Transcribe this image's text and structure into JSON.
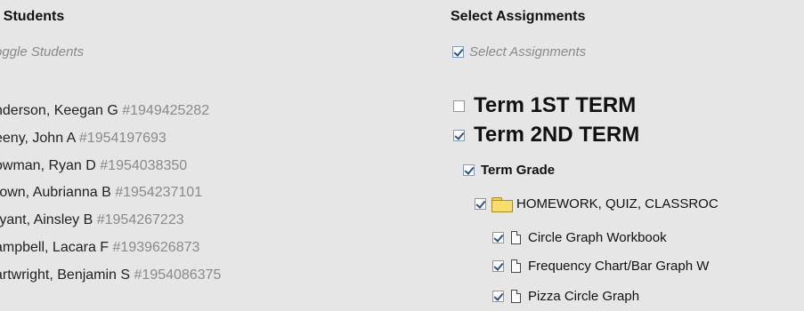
{
  "students_panel": {
    "title": "t Students",
    "toggle_label": "oggle Students",
    "students": [
      {
        "name": "nderson, Keegan G",
        "id": "#1949425282"
      },
      {
        "name": "eeny, John A",
        "id": "#1954197693"
      },
      {
        "name": "owman, Ryan D",
        "id": "#1954038350"
      },
      {
        "name": "rown, Aubrianna B",
        "id": "#1954237101"
      },
      {
        "name": "ryant, Ainsley B",
        "id": "#1954267223"
      },
      {
        "name": "ampbell, Lacara F",
        "id": "#1939626873"
      },
      {
        "name": "artwright, Benjamin S",
        "id": "#1954086375"
      }
    ]
  },
  "assignments_panel": {
    "title": "Select Assignments",
    "toggle_label": "Select Assignments",
    "terms": [
      {
        "label": "Term 1ST TERM",
        "checked": false
      },
      {
        "label": "Term 2ND TERM",
        "checked": true
      }
    ],
    "grade": {
      "label": "Term Grade",
      "checked": true
    },
    "category": {
      "label": "HOMEWORK, QUIZ, CLASSROC",
      "icon": "folder-icon",
      "checked": true
    },
    "items": [
      {
        "label": "Circle Graph Workbook",
        "icon": "document-icon",
        "checked": true
      },
      {
        "label": "Frequency Chart/Bar Graph W",
        "icon": "document-icon",
        "checked": true
      },
      {
        "label": "Pizza Circle Graph",
        "icon": "document-icon",
        "checked": true
      }
    ]
  }
}
